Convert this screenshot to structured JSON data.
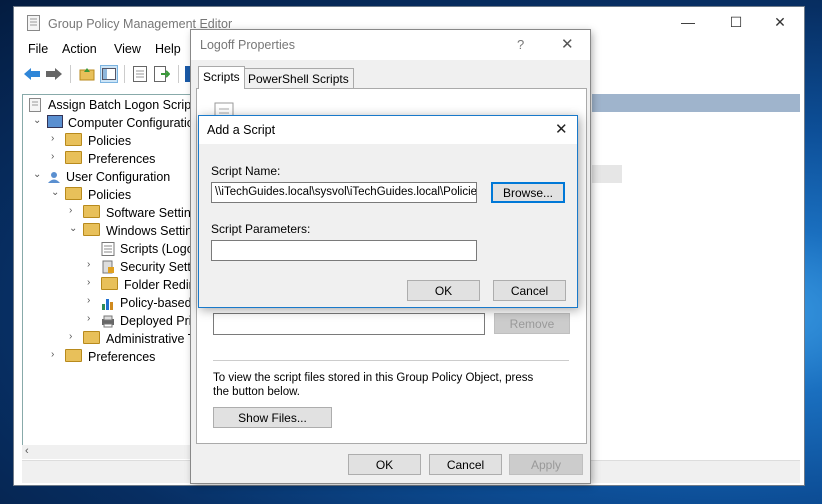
{
  "main_window": {
    "title": "Group Policy Management Editor",
    "menu": [
      "File",
      "Action",
      "View",
      "Help"
    ],
    "tree": {
      "root": "Assign Batch Logon Script [",
      "computer_configuration": "Computer Configuration",
      "cc_policies": "Policies",
      "cc_preferences": "Preferences",
      "user_configuration": "User Configuration",
      "uc_policies": "Policies",
      "software_settings": "Software Setting",
      "windows_settings": "Windows Setting",
      "scripts": "Scripts (Logo",
      "security_settings": "Security Setti",
      "folder_redirection": "Folder Redire",
      "policy_based": "Policy-based",
      "deployed_printers": "Deployed Pri",
      "admin_templates": "Administrative T",
      "uc_preferences": "Preferences"
    }
  },
  "logoff_dialog": {
    "title": "Logoff Properties",
    "help_glyph": "?",
    "tabs": [
      "Scripts",
      "PowerShell Scripts"
    ],
    "remove_label": "Remove",
    "info_text_line1": "To view the script files stored in this Group Policy Object, press",
    "info_text_line2": "the button below.",
    "show_files_label": "Show Files...",
    "ok_label": "OK",
    "cancel_label": "Cancel",
    "apply_label": "Apply"
  },
  "add_script_dialog": {
    "title": "Add a Script",
    "script_name_label": "Script Name:",
    "script_name_value": "\\\\iTechGuides.local\\sysvol\\iTechGuides.local\\Policies",
    "browse_label": "Browse...",
    "script_params_label": "Script Parameters:",
    "script_params_value": "",
    "ok_label": "OK",
    "cancel_label": "Cancel"
  },
  "icons": [
    "gpo-window-icon",
    "back-arrow-icon",
    "forward-arrow-icon",
    "folder-up-icon",
    "console-tree-icon",
    "properties-icon",
    "export-icon",
    "script-icon",
    "folder-icon",
    "security-icon",
    "chart-icon",
    "printer-icon",
    "close-icon"
  ],
  "colors": {
    "accent": "#0078d7",
    "folder": "#e8c05a",
    "desktop": "#0d4f98"
  }
}
